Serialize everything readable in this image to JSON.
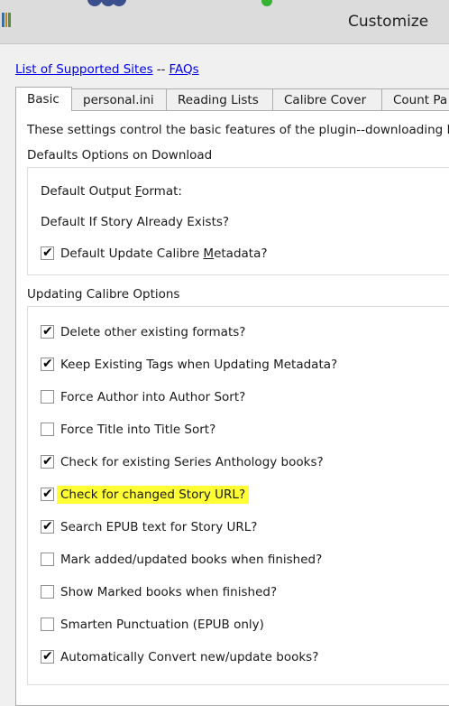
{
  "window": {
    "title": "Customize"
  },
  "links": {
    "supported_sites": "List of Supported Sites",
    "separator": "--",
    "faqs": "FAQs"
  },
  "tabs": [
    {
      "label": "Basic"
    },
    {
      "label": "personal.ini"
    },
    {
      "label": "Reading Lists"
    },
    {
      "label": "Calibre Cover"
    },
    {
      "label": "Count Pa"
    }
  ],
  "basic": {
    "intro": "These settings control the basic features of the plugin--downloading Fa",
    "defaults": {
      "title": "Defaults Options on Download",
      "output_format": {
        "pre": "Default Output ",
        "mn": "F",
        "post": "ormat:"
      },
      "if_exists": {
        "label": "Default If Story Already Exists?"
      },
      "update_metadata": {
        "pre": "Default Update Calibre ",
        "mn": "M",
        "post": "etadata?",
        "checked": true
      }
    },
    "updating": {
      "title": "Updating Calibre Options",
      "options": [
        {
          "label": "Delete other existing formats?",
          "checked": true
        },
        {
          "label": "Keep Existing Tags when Updating Metadata?",
          "checked": true
        },
        {
          "label": "Force Author into Author Sort?",
          "checked": false
        },
        {
          "label": "Force Title into Title Sort?",
          "checked": false
        },
        {
          "label": "Check for existing Series Anthology books?",
          "checked": true
        },
        {
          "label": "Check for changed Story URL?",
          "checked": true
        },
        {
          "label": "Search EPUB text for Story URL?",
          "checked": true
        },
        {
          "label": "Mark added/updated books when finished?",
          "checked": false
        },
        {
          "label": "Show Marked books when finished?",
          "checked": false
        },
        {
          "label": "Smarten Punctuation (EPUB only)",
          "checked": false
        },
        {
          "label": "Automatically Convert new/update books?",
          "checked": true
        }
      ]
    }
  },
  "colors": {
    "highlight": "#ffff33",
    "link": "#0000ee"
  },
  "check_glyph": "✔"
}
